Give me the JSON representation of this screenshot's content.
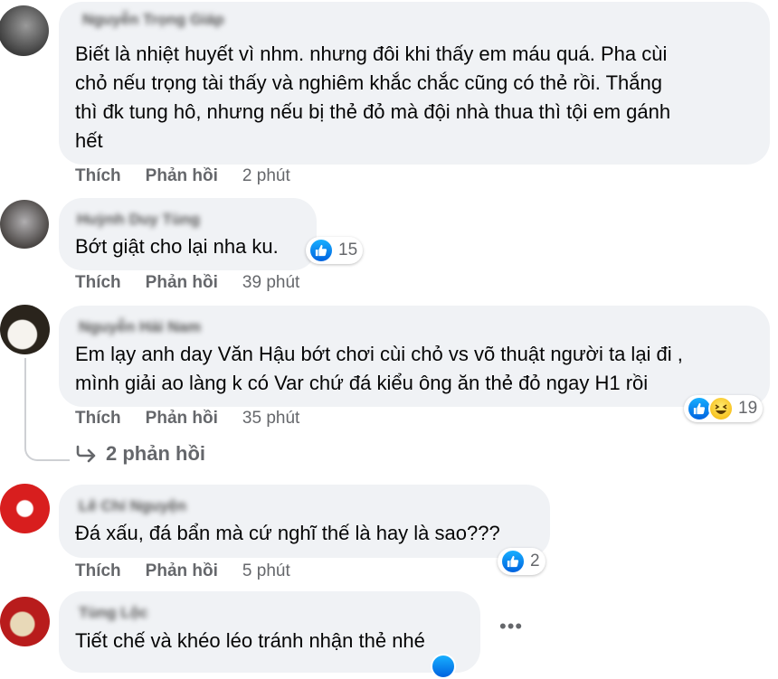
{
  "actions": {
    "like": "Thích",
    "reply": "Phản hồi"
  },
  "comments": [
    {
      "author": "Nguyễn Trọng Giáp",
      "text": "Biết là nhiệt huyết vì nhm. nhưng đôi khi thấy em máu quá. Pha cùi\nchỏ nếu trọng tài thấy và nghiêm khắc chắc cũng có thẻ rồi. Thắng\nthì đk tung hô, nhưng nếu bị thẻ đỏ mà đội nhà thua thì tội em gánh\nhết",
      "time": "2 phút"
    },
    {
      "author": "Huỳnh Duy Tùng",
      "text": "Bớt giật cho lại nha ku.",
      "time": "39 phút",
      "reaction_count": "15"
    },
    {
      "author": "Nguyễn Hải Nam",
      "text": "Em lạy anh day Văn Hậu bớt chơi cùi chỏ vs võ thuật người ta lại đi ,\nmình giải ao làng k có Var chứ đá kiểu ông ăn thẻ đỏ ngay H1 rồi",
      "time": "35 phút",
      "reaction_count": "19",
      "replies_label": "2 phản hồi"
    },
    {
      "author": "Lê Chí Nguyện",
      "text": "Đá xấu, đá bẩn mà cứ nghĩ thế là hay là sao???",
      "time": "5 phút",
      "reaction_count": "2"
    },
    {
      "author": "Tùng Lộc",
      "text": "Tiết chế và khéo léo tránh nhận thẻ nhé"
    }
  ],
  "colors": {
    "bubble": "#f0f2f5",
    "like_blue": "#0866ff",
    "muted_text": "#65676b"
  },
  "icons": [
    "like-icon",
    "haha-icon",
    "reply-arrow-icon",
    "more-options-icon"
  ]
}
